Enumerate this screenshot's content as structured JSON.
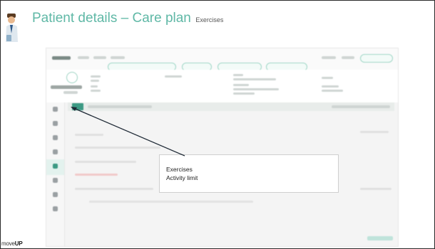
{
  "slide": {
    "title": "Patient details – Care plan",
    "subtitle": "Exercises",
    "brand_left": "move",
    "brand_right": "UP"
  },
  "callout": {
    "line1": "Exercises",
    "line2": "Activity limit"
  },
  "colors": {
    "title": "#5fb8a6",
    "accent_green": "#3c9a84",
    "border": "#2a2a2a"
  }
}
